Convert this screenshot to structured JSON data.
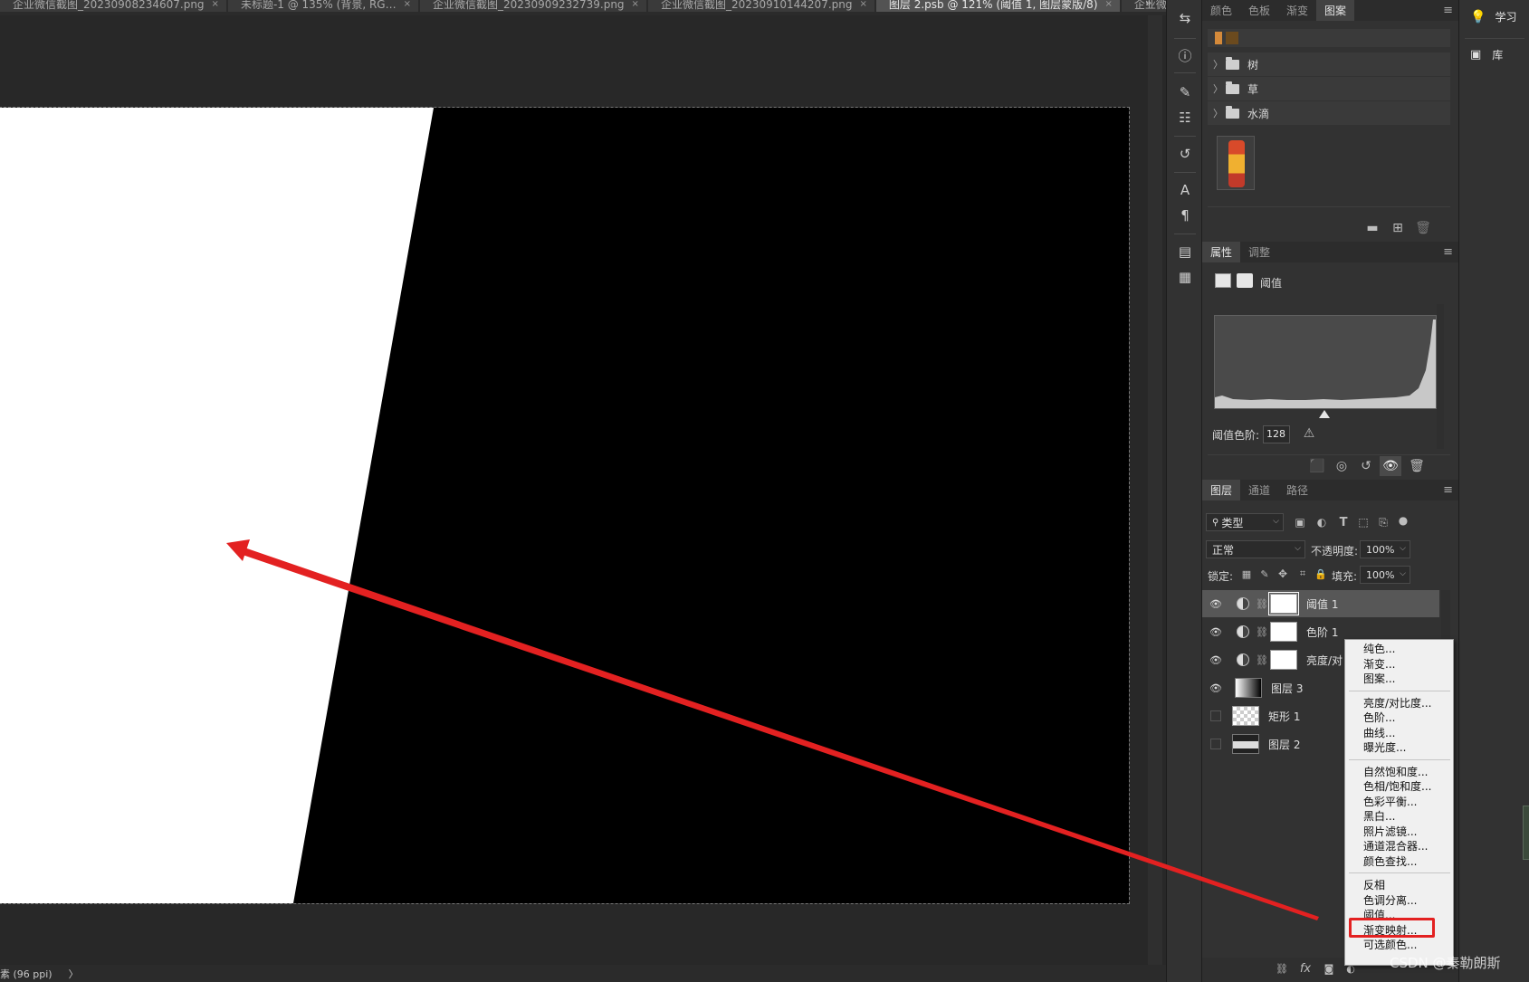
{
  "doc_tabs": [
    {
      "label": "企业微信截图_20230908234607.png",
      "active": false
    },
    {
      "label": "未标题-1 @ 135% (背景, RG…",
      "active": false
    },
    {
      "label": "企业微信截图_20230909232739.png",
      "active": false
    },
    {
      "label": "企业微信截图_20230910144207.png",
      "active": false
    },
    {
      "label": "图层 2.psb @ 121% (阈值 1, 图层蒙版/8)",
      "active": true
    },
    {
      "label": "企业微信截图_202",
      "active": false
    }
  ],
  "tab_overflow": "»",
  "statusbar": {
    "text": "素 (96 ppi)",
    "arrow": "〉"
  },
  "panel_top": {
    "tabs": [
      {
        "label": "颜色",
        "active": false
      },
      {
        "label": "色板",
        "active": false
      },
      {
        "label": "渐变",
        "active": false
      },
      {
        "label": "图案",
        "active": true
      }
    ],
    "menu_icon": "≡",
    "pattern_groups": [
      {
        "arrow": "〉",
        "name": "树"
      },
      {
        "arrow": "〉",
        "name": "草"
      },
      {
        "arrow": "〉",
        "name": "水滴"
      }
    ]
  },
  "properties": {
    "tabs": [
      {
        "label": "属性",
        "active": true
      },
      {
        "label": "调整",
        "active": false
      }
    ],
    "menu_icon": "≡",
    "title": "阈值",
    "threshold_label": "阈值色阶:",
    "threshold_value": "128"
  },
  "layers": {
    "tabs": [
      {
        "label": "图层",
        "active": true
      },
      {
        "label": "通道",
        "active": false
      },
      {
        "label": "路径",
        "active": false
      }
    ],
    "menu_icon": "≡",
    "filter_type": "类型",
    "blend_mode": "正常",
    "opacity_label": "不透明度:",
    "opacity_value": "100%",
    "lock_label": "锁定:",
    "fill_label": "填充:",
    "fill_value": "100%",
    "items": [
      {
        "name": "阈值 1",
        "kind": "adjustment",
        "visible": true,
        "selected": true
      },
      {
        "name": "色阶 1",
        "kind": "adjustment",
        "visible": true,
        "selected": false
      },
      {
        "name": "亮度/对",
        "kind": "adjustment",
        "visible": true,
        "selected": false
      },
      {
        "name": "图层 3",
        "kind": "gradient",
        "visible": true,
        "selected": false
      },
      {
        "name": "矩形 1",
        "kind": "shape",
        "visible": false,
        "selected": false
      },
      {
        "name": "图层 2",
        "kind": "image",
        "visible": false,
        "selected": false
      }
    ],
    "fx_label": "fx"
  },
  "context_menu": {
    "groups": [
      [
        "纯色...",
        "渐变...",
        "图案..."
      ],
      [
        "亮度/对比度...",
        "色阶...",
        "曲线...",
        "曝光度..."
      ],
      [
        "自然饱和度...",
        "色相/饱和度...",
        "色彩平衡...",
        "黑白...",
        "照片滤镜...",
        "通道混合器...",
        "颜色查找..."
      ],
      [
        "反相",
        "色调分离...",
        "阈值...",
        "渐变映射...",
        "可选颜色..."
      ]
    ],
    "highlighted": "阈值..."
  },
  "far_right": [
    {
      "icon": "lightbulb-icon",
      "label": "学习"
    },
    {
      "icon": "library-icon",
      "label": "库"
    }
  ],
  "watermark": "CSDN @秦勒朗斯",
  "colors": {
    "annotation": "#e32121",
    "canvas_black": "#000000",
    "canvas_white": "#ffffff"
  }
}
